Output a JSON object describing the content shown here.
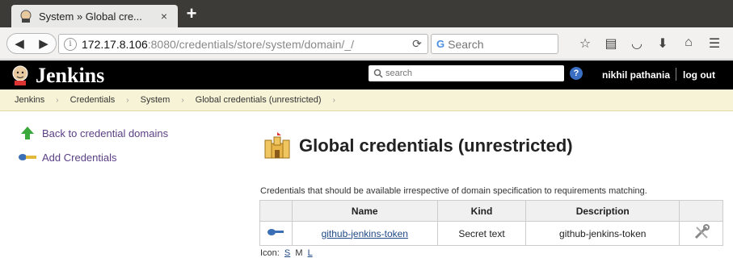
{
  "browser": {
    "tab_title": "System » Global cre...",
    "tab_close": "×",
    "new_tab": "+",
    "url_host": "172.17.8.106",
    "url_rest": ":8080/credentials/store/system/domain/_/",
    "search_placeholder": "Search"
  },
  "jenkins": {
    "title": "Jenkins",
    "search_placeholder": "search",
    "help": "?",
    "user": "nikhil pathania",
    "logout": "log out"
  },
  "breadcrumb": [
    "Jenkins",
    "Credentials",
    "System",
    "Global credentials (unrestricted)"
  ],
  "sidebar": {
    "items": [
      {
        "label": "Back to credential domains",
        "icon": "up-arrow-icon"
      },
      {
        "label": "Add Credentials",
        "icon": "key-icon"
      }
    ]
  },
  "main": {
    "title": "Global credentials (unrestricted)",
    "description": "Credentials that should be available irrespective of domain specification to requirements matching.",
    "columns": [
      "Name",
      "Kind",
      "Description"
    ],
    "rows": [
      {
        "name": "github-jenkins-token",
        "kind": "Secret text",
        "description": "github-jenkins-token"
      }
    ],
    "icon_label": "Icon:",
    "icon_sizes": [
      "S",
      "M",
      "L"
    ]
  },
  "colors": {
    "header_bg": "#000000",
    "breadcrumb_bg": "#f7f3d6",
    "link": "#204a87",
    "side_link": "#5a3e85"
  }
}
